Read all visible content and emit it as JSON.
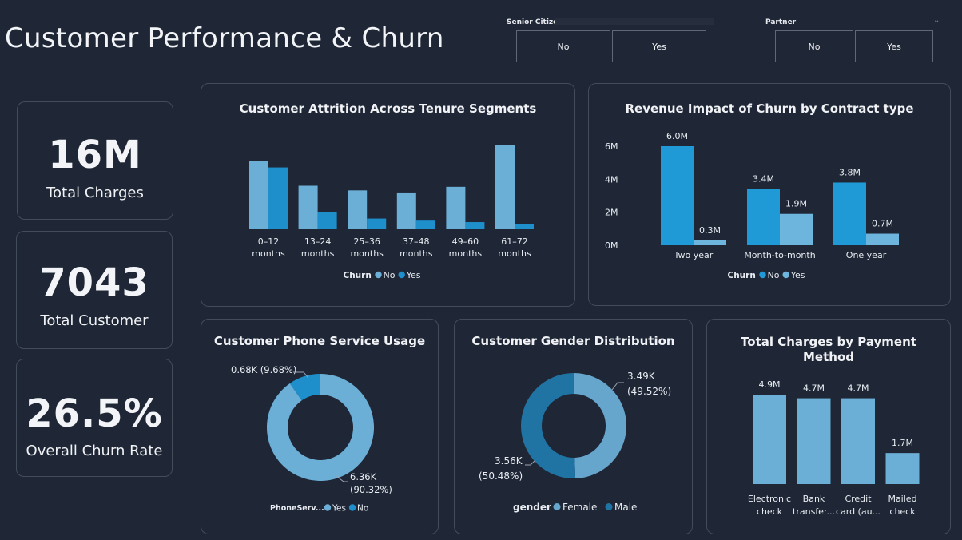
{
  "title": "Customer Performance & Churn",
  "slicers": [
    {
      "label": "Senior Citizen",
      "options": [
        "No",
        "Yes"
      ]
    },
    {
      "label": "Partner",
      "options": [
        "No",
        "Yes"
      ]
    }
  ],
  "kpis": [
    {
      "value": "16M",
      "label": "Total Charges"
    },
    {
      "value": "7043",
      "label": "Total Customer"
    },
    {
      "value": "26.5%",
      "label": "Overall Churn Rate"
    }
  ],
  "colors": {
    "light": "#6baed6",
    "dark": "#1f8fcc",
    "female": "#66a6cd",
    "male": "#1f74a4"
  },
  "chart_data": [
    {
      "type": "bar",
      "title": "Customer Attrition Across Tenure Segments",
      "categories": [
        "0–12 months",
        "13–24 months",
        "25–36 months",
        "37–48 months",
        "49–60 months",
        "61–72 months"
      ],
      "series": [
        {
          "name": "No",
          "values": [
            1145,
            730,
            652,
            617,
            712,
            1407
          ],
          "color": "#6baed6"
        },
        {
          "name": "Yes",
          "values": [
            1037,
            294,
            180,
            145,
            120,
            93
          ],
          "color": "#1f8fcc"
        }
      ],
      "ylim": [
        0,
        1500
      ],
      "legend_title": "Churn",
      "legend_position": "bottom-center"
    },
    {
      "type": "bar",
      "title": "Revenue Impact of Churn by Contract type",
      "categories": [
        "Two year",
        "Month-to-month",
        "One year"
      ],
      "series": [
        {
          "name": "No",
          "values": [
            6.0,
            3.4,
            3.8
          ],
          "labels": [
            "6.0M",
            "3.4M",
            "3.8M"
          ],
          "color": "#1f9ad6"
        },
        {
          "name": "Yes",
          "values": [
            0.3,
            1.9,
            0.7
          ],
          "labels": [
            "0.3M",
            "1.9M",
            "0.7M"
          ],
          "color": "#6db5dc"
        }
      ],
      "yticks": [
        "0M",
        "2M",
        "4M",
        "6M"
      ],
      "ylim": [
        0,
        6.4
      ],
      "legend_title": "Churn",
      "legend_position": "bottom-center"
    },
    {
      "type": "pie",
      "subtype": "donut",
      "title": "Customer Phone Service Usage",
      "series": [
        {
          "name": "Yes",
          "value": 6.36,
          "label": "6.36K",
          "pct": "(90.32%)",
          "color": "#6baed6"
        },
        {
          "name": "No",
          "value": 0.68,
          "label": "0.68K (9.68%)",
          "color": "#1f8fcc"
        }
      ],
      "legend_title": "PhoneServ...",
      "legend_position": "bottom-center"
    },
    {
      "type": "pie",
      "subtype": "donut",
      "title": "Customer Gender Distribution",
      "series": [
        {
          "name": "Female",
          "value": 3.49,
          "label": "3.49K",
          "pct": "(49.52%)",
          "color": "#66a6cd"
        },
        {
          "name": "Male",
          "value": 3.56,
          "label": "3.56K",
          "pct": "(50.48%)",
          "color": "#1f74a4"
        }
      ],
      "legend_title": "gender",
      "legend_position": "bottom-center"
    },
    {
      "type": "bar",
      "title_lines": [
        "Total Charges by Payment",
        "Method"
      ],
      "categories": [
        [
          "Electronic",
          "check"
        ],
        [
          "Bank",
          "transfer..."
        ],
        [
          "Credit",
          "card (au..."
        ],
        [
          "Mailed",
          "check"
        ]
      ],
      "values": [
        4.9,
        4.7,
        4.7,
        1.7
      ],
      "labels": [
        "4.9M",
        "4.7M",
        "4.7M",
        "1.7M"
      ],
      "color": "#6baed6",
      "ylim": [
        0,
        4.9
      ]
    }
  ]
}
